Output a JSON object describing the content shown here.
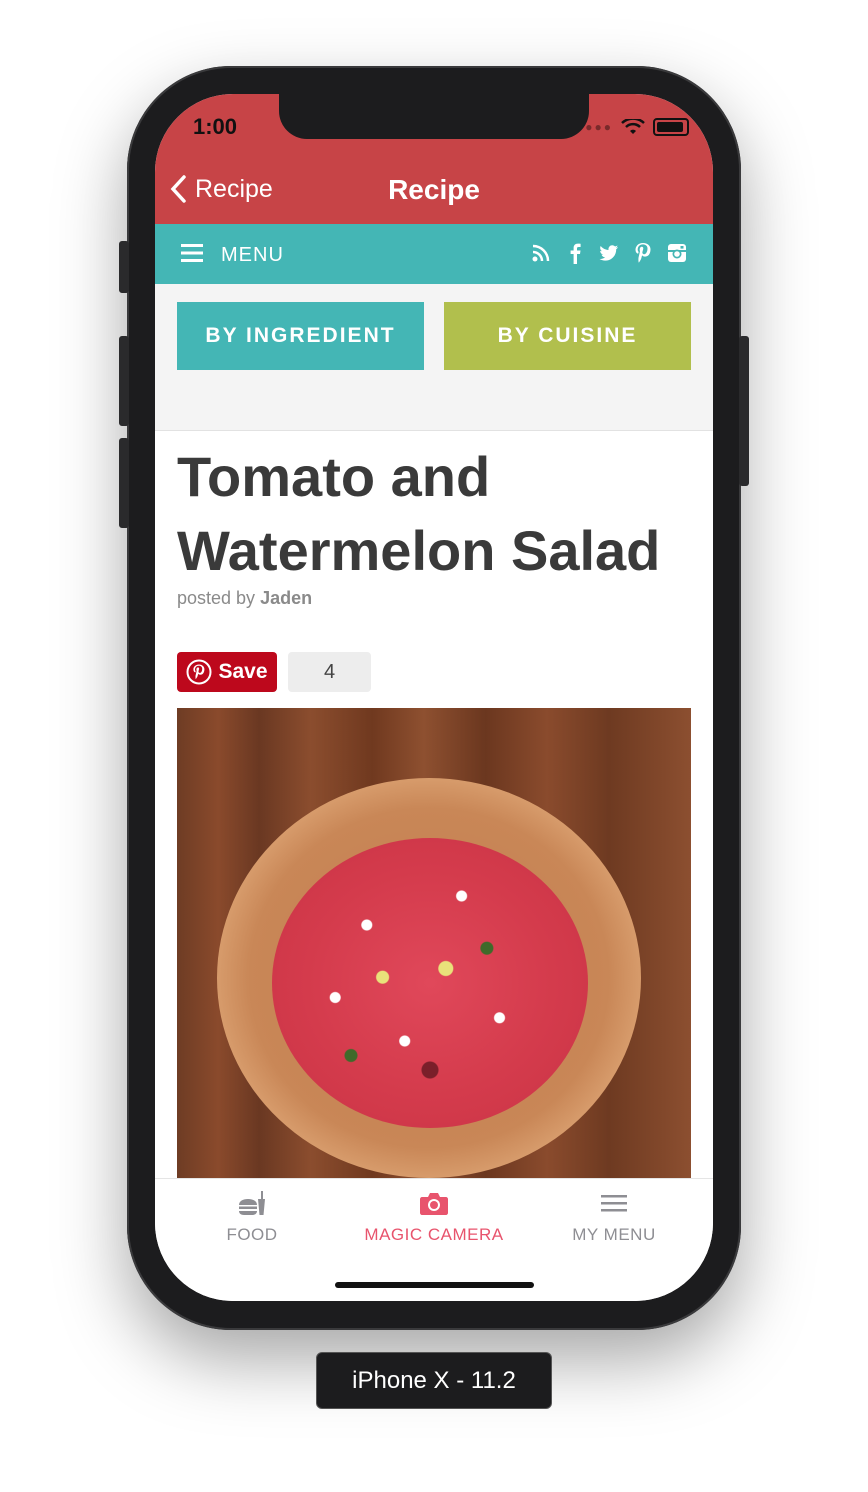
{
  "device_label": "iPhone X - 11.2",
  "status": {
    "time": "1:00"
  },
  "nav": {
    "back_label": "Recipe",
    "title": "Recipe"
  },
  "menubar": {
    "menu_label": "MENU",
    "social_icons": [
      "rss-icon",
      "facebook-icon",
      "twitter-icon",
      "pinterest-icon",
      "instagram-icon"
    ]
  },
  "filters": {
    "by_ingredient": "BY INGREDIENT",
    "by_cuisine": "BY CUISINE"
  },
  "recipe": {
    "title_line1": "Tomato and",
    "title_line2": "Watermelon Salad",
    "posted_by_prefix": "posted by",
    "author": "Jaden",
    "pin_save_label": "Save",
    "pin_count": "4"
  },
  "tabs": [
    {
      "label": "FOOD",
      "icon": "food-icon"
    },
    {
      "label": "MAGIC CAMERA",
      "icon": "camera-icon"
    },
    {
      "label": "MY MENU",
      "icon": "list-icon"
    }
  ],
  "colors": {
    "nav_red": "#c74447",
    "teal": "#44b6b5",
    "olive": "#b1bf4d",
    "pinterest_red": "#bd081c",
    "active_tab_pink": "#e8546d"
  }
}
